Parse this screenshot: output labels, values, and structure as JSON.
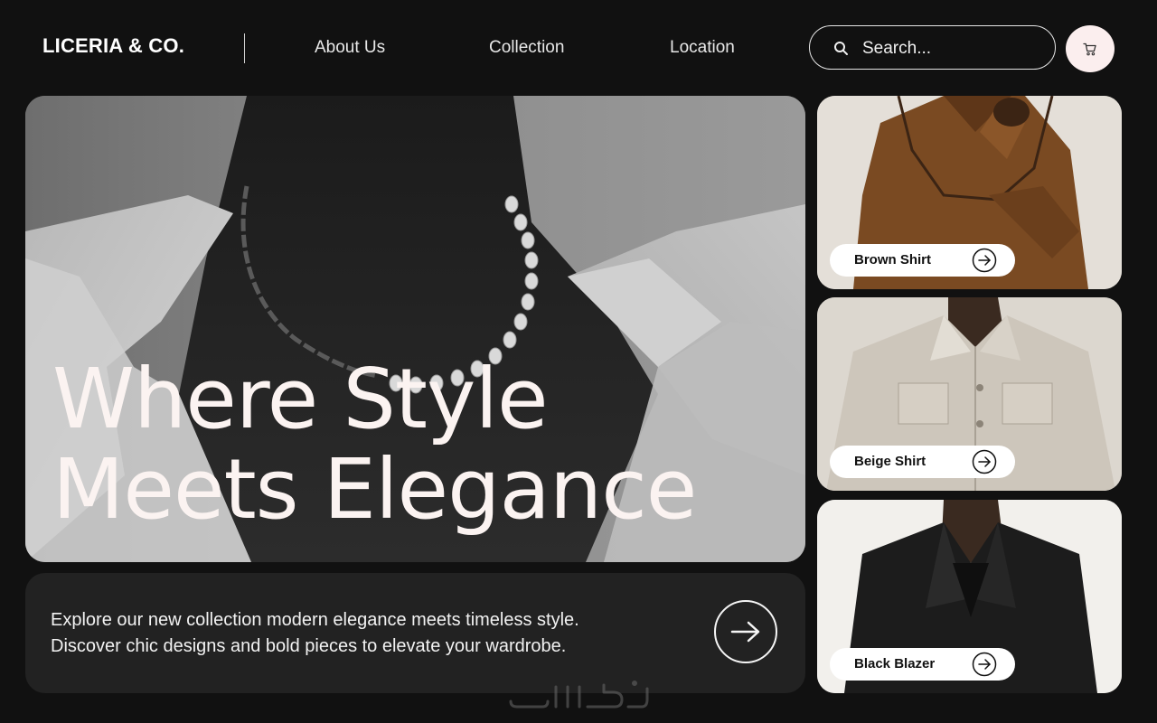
{
  "header": {
    "brand": "LICERIA & CO.",
    "nav": [
      {
        "label": "About Us"
      },
      {
        "label": "Collection"
      },
      {
        "label": "Location"
      }
    ],
    "search": {
      "placeholder": "Search..."
    },
    "cart_icon": "cart-icon",
    "search_icon": "search-icon"
  },
  "hero": {
    "title_line1": "Where Style",
    "title_line2": "Meets Elegance"
  },
  "intro": {
    "line1": "Explore our new collection modern elegance meets timeless style.",
    "line2": "Discover chic designs and bold pieces to elevate your wardrobe.",
    "arrow_icon": "arrow-right-icon"
  },
  "products": [
    {
      "name": "Brown Shirt"
    },
    {
      "name": "Beige Shirt"
    },
    {
      "name": "Black Blazer"
    }
  ],
  "colors": {
    "background": "#111111",
    "card": "#222222",
    "accent": "#fbeeee",
    "text": "#fbf3f1"
  }
}
